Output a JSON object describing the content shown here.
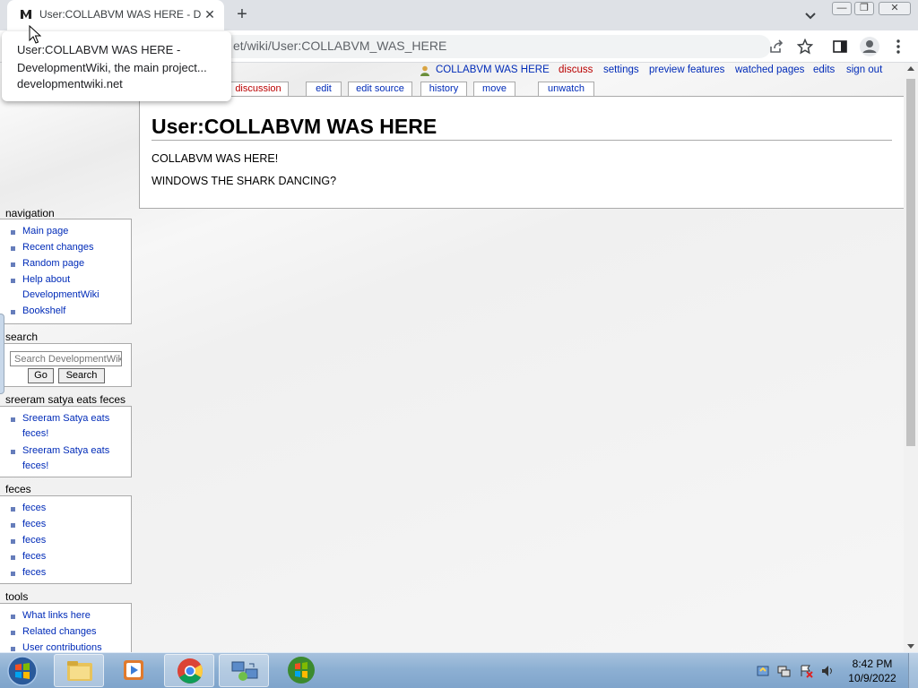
{
  "browser": {
    "tab_title": "User:COLLABVM WAS HERE - DevelopmentWiki, the main project",
    "url_visible": "et/wiki/User:COLLABVM_WAS_HERE",
    "tooltip_title": "User:COLLABVM WAS HERE - DevelopmentWiki, the main project...",
    "tooltip_url": "developmentwiki.net"
  },
  "personal_tools": {
    "username": "COLLABVM WAS HERE",
    "discuss": "discuss",
    "settings": "settings",
    "preview_features": "preview features",
    "watched_pages": "watched pages",
    "edits": "edits",
    "sign_out": "sign out"
  },
  "content_tabs": {
    "discussion": "discussion",
    "edit": "edit",
    "edit_source": "edit source",
    "history": "history",
    "move": "move",
    "unwatch": "unwatch"
  },
  "article": {
    "heading": "User:COLLABVM WAS HERE",
    "paragraphs": [
      "COLLABVM WAS HERE!",
      "WINDOWS THE SHARK DANCING?"
    ]
  },
  "sidebar": {
    "navigation": {
      "heading": "navigation",
      "items": [
        "Main page",
        "Recent changes",
        "Random page",
        "Help about",
        "DevelopmentWiki",
        "Bookshelf"
      ]
    },
    "search": {
      "heading": "search",
      "placeholder": "Search DevelopmentWiki",
      "go": "Go",
      "search": "Search"
    },
    "sreeram": {
      "heading": "sreeram satya eats feces",
      "items": [
        "Sreeram Satya eats",
        "feces!",
        "Sreeram Satya eats",
        "feces!"
      ]
    },
    "feces": {
      "heading": "feces",
      "items": [
        "feces",
        "feces",
        "feces",
        "feces",
        "feces"
      ]
    },
    "tools": {
      "heading": "tools",
      "items": [
        "What links here",
        "Related changes",
        "User contributions"
      ]
    }
  },
  "taskbar": {
    "time": "8:42 PM",
    "date": "10/9/2022"
  },
  "colors": {
    "link": "#002bb8",
    "redlink": "#ba0000",
    "taskbar": "#8db0d3"
  }
}
